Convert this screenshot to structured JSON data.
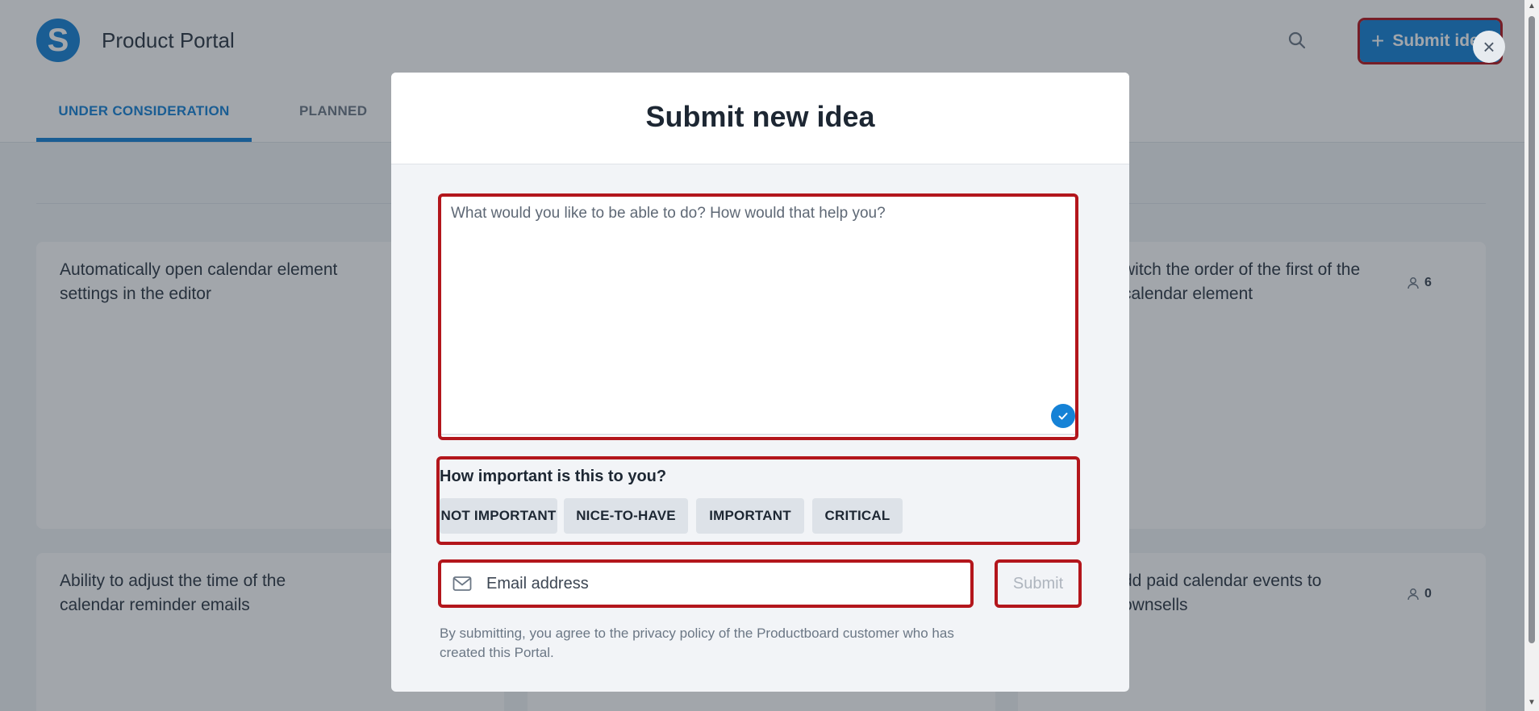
{
  "header": {
    "logo_letter": "S",
    "portal_title": "Product Portal",
    "submit_idea_label": "Submit idea"
  },
  "tabs": [
    {
      "label": "UNDER CONSIDERATION",
      "active": true
    },
    {
      "label": "PLANNED",
      "active": false
    }
  ],
  "cards": [
    {
      "title": "Automatically open calendar element settings in the editor",
      "votes": ""
    },
    {
      "title": "witch the order of the first of the calendar element",
      "votes": "6"
    },
    {
      "title": "Ability to adjust the time of the calendar reminder emails",
      "votes": ""
    },
    {
      "title": "dd paid calendar events to ownsells",
      "votes": "0"
    }
  ],
  "modal": {
    "title": "Submit new idea",
    "idea_placeholder": "What would you like to be able to do? How would that help you?",
    "importance_question": "How important is this to you?",
    "importance_options": [
      "NOT IMPORTANT",
      "NICE-TO-HAVE",
      "IMPORTANT",
      "CRITICAL"
    ],
    "email_placeholder": "Email address",
    "submit_label": "Submit",
    "disclaimer": "By submitting, you agree to the privacy policy of the Productboard customer who has created this Portal."
  },
  "colors": {
    "accent": "#1582d6",
    "highlight": "#b3161c"
  }
}
